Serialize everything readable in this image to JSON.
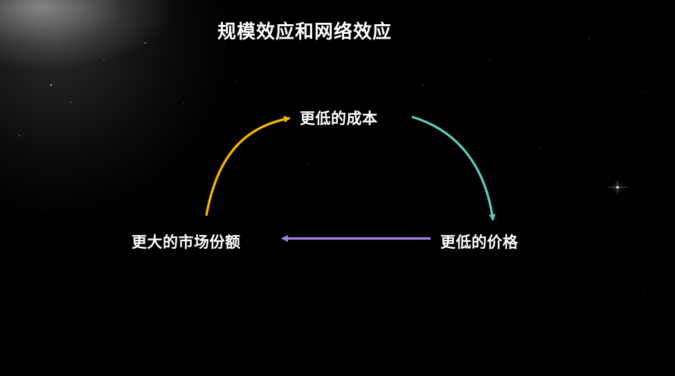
{
  "title": "规模效应和网络效应",
  "nodes": {
    "top": "更低的成本",
    "right": "更低的价格",
    "left": "更大的市场份额"
  },
  "colors": {
    "arrow_to_top": "#f5b400",
    "arrow_to_right": "#5ec8b8",
    "arrow_to_left": "#9b83e0",
    "text": "#ffffff",
    "background": "#000000"
  }
}
